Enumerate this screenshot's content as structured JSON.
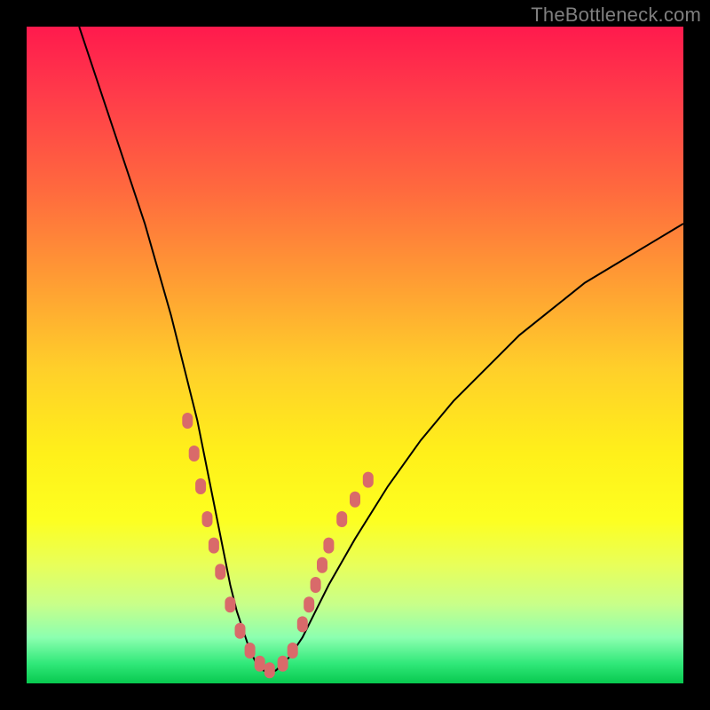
{
  "watermark": "TheBottleneck.com",
  "colors": {
    "frame": "#000000",
    "gradient_top": "#ff1a4d",
    "gradient_bottom": "#08c94f",
    "curve": "#000000",
    "markers": "#d96a6a"
  },
  "chart_data": {
    "type": "line",
    "title": "",
    "xlabel": "",
    "ylabel": "",
    "xlim": [
      0,
      100
    ],
    "ylim": [
      0,
      100
    ],
    "series": [
      {
        "name": "bottleneck-curve",
        "x": [
          8,
          10,
          12,
          14,
          16,
          18,
          20,
          22,
          24,
          26,
          27,
          28,
          29,
          30,
          31,
          32,
          33,
          34,
          35,
          36,
          37,
          38,
          40,
          42,
          44,
          46,
          50,
          55,
          60,
          65,
          70,
          75,
          80,
          85,
          90,
          95,
          100
        ],
        "values": [
          100,
          94,
          88,
          82,
          76,
          70,
          63,
          56,
          48,
          40,
          35,
          30,
          25,
          20,
          15,
          11,
          8,
          5,
          3,
          2,
          1.5,
          2,
          4,
          7,
          11,
          15,
          22,
          30,
          37,
          43,
          48,
          53,
          57,
          61,
          64,
          67,
          70
        ]
      }
    ],
    "markers": {
      "name": "highlighted-points",
      "x": [
        24.5,
        25.5,
        26.5,
        27.5,
        28.5,
        29.5,
        31,
        32.5,
        34,
        35.5,
        37,
        39,
        40.5,
        42,
        43,
        44,
        45,
        46,
        48,
        50,
        52
      ],
      "values": [
        40,
        35,
        30,
        25,
        21,
        17,
        12,
        8,
        5,
        3,
        2,
        3,
        5,
        9,
        12,
        15,
        18,
        21,
        25,
        28,
        31
      ]
    },
    "annotations": [
      {
        "text": "TheBottleneck.com",
        "position": "top-right"
      }
    ]
  }
}
